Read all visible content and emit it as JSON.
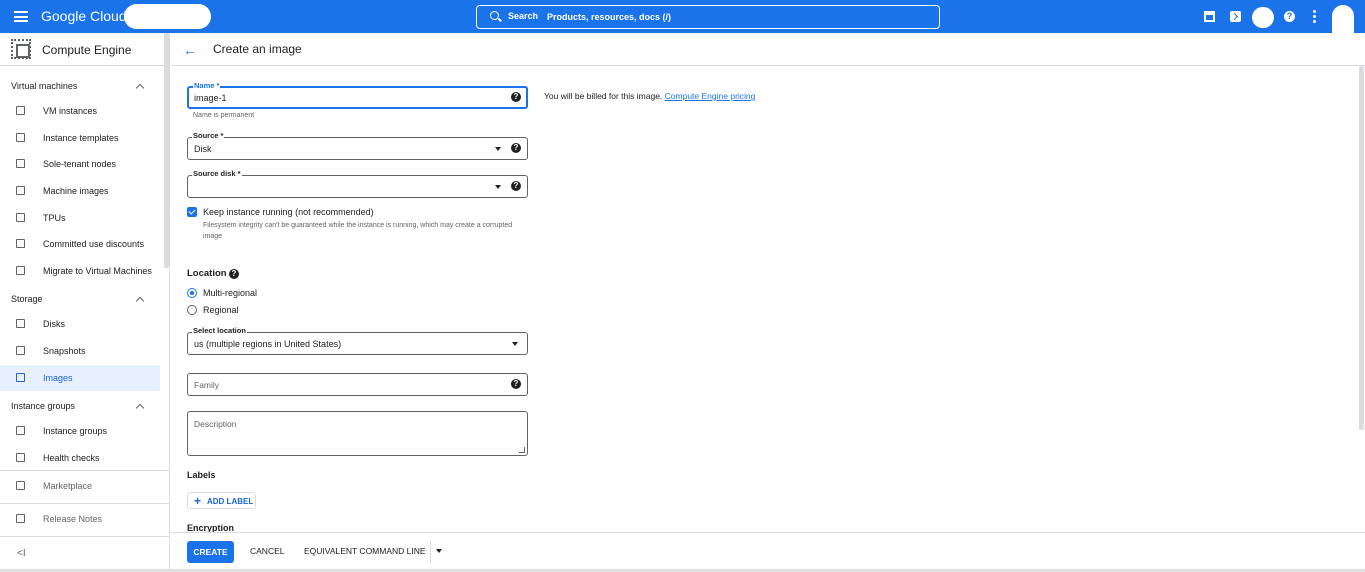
{
  "topbar": {
    "logo": "Google Cloud",
    "search_label": "Search",
    "search_placeholder": "Products, resources, docs (/)",
    "help_glyph": "?"
  },
  "sidebar": {
    "title": "Compute Engine",
    "sections": {
      "vm": "Virtual machines",
      "storage": "Storage",
      "groups": "Instance groups"
    },
    "items": {
      "vm_instances": "VM instances",
      "instance_templates": "Instance templates",
      "sole_tenant": "Sole-tenant nodes",
      "machine_images": "Machine images",
      "tpus": "TPUs",
      "committed": "Committed use discounts",
      "migrate": "Migrate to Virtual Machines",
      "disks": "Disks",
      "snapshots": "Snapshots",
      "images": "Images",
      "instance_groups": "Instance groups",
      "health_checks": "Health checks",
      "marketplace": "Marketplace",
      "release_notes": "Release Notes"
    },
    "collapse_glyph": "<I"
  },
  "page": {
    "back_glyph": "←",
    "title": "Create an image"
  },
  "form": {
    "name_label": "Name *",
    "name_value": "image-1",
    "name_hint": "Name is permanent",
    "billing_text": "You will be billed for this image.",
    "billing_link": "Compute Engine pricing",
    "source_label": "Source *",
    "source_value": "Disk",
    "source_disk_label": "Source disk *",
    "keep_running_label": "Keep instance running (not recommended)",
    "keep_running_sub": "Filesystem integrity can't be guaranteed while the instance is running, which may create a corrupted image",
    "location_heading": "Location",
    "radio_multi": "Multi-regional",
    "radio_regional": "Regional",
    "select_location_label": "Select location",
    "select_location_value": "us (multiple regions in United States)",
    "family_placeholder": "Family",
    "description_placeholder": "Description",
    "labels_heading": "Labels",
    "add_label_plus": "+",
    "add_label": "ADD LABEL",
    "encryption_heading": "Encryption",
    "help_glyph": "?"
  },
  "footer": {
    "create": "CREATE",
    "cancel": "CANCEL",
    "equivalent": "EQUIVALENT COMMAND LINE"
  }
}
